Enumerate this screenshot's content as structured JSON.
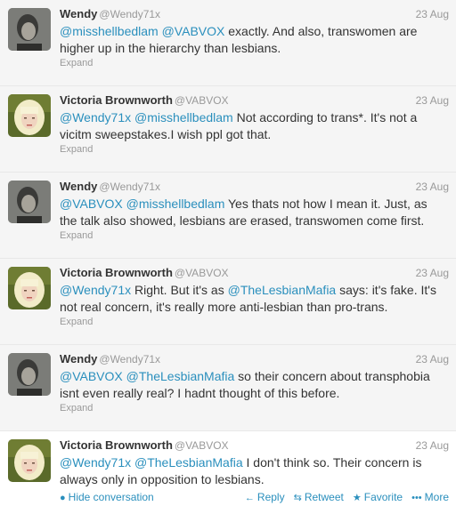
{
  "tweets": [
    {
      "fullname": "Wendy",
      "username": "@Wendy71x",
      "time": "23 Aug",
      "avatar": "wendy",
      "text_segments": [
        {
          "t": "@misshellbedlam",
          "m": true
        },
        {
          "t": " ",
          "m": false
        },
        {
          "t": "@VABVOX",
          "m": true
        },
        {
          "t": " exactly. And also, transwomen are higher up in the hierarchy than lesbians.",
          "m": false
        }
      ],
      "expand_label": "Expand"
    },
    {
      "fullname": "Victoria Brownworth",
      "username": "@VABVOX",
      "time": "23 Aug",
      "avatar": "victoria",
      "text_segments": [
        {
          "t": "@Wendy71x",
          "m": true
        },
        {
          "t": " ",
          "m": false
        },
        {
          "t": "@misshellbedlam",
          "m": true
        },
        {
          "t": " Not according to trans*. It's not a vicitm sweepstakes.I wish ppl got that.",
          "m": false
        }
      ],
      "expand_label": "Expand"
    },
    {
      "fullname": "Wendy",
      "username": "@Wendy71x",
      "time": "23 Aug",
      "avatar": "wendy",
      "text_segments": [
        {
          "t": "@VABVOX",
          "m": true
        },
        {
          "t": " ",
          "m": false
        },
        {
          "t": "@misshellbedlam",
          "m": true
        },
        {
          "t": " Yes thats not how I mean it. Just, as the talk also showed, lesbians are erased, transwomen come first.",
          "m": false
        }
      ],
      "expand_label": "Expand"
    },
    {
      "fullname": "Victoria Brownworth",
      "username": "@VABVOX",
      "time": "23 Aug",
      "avatar": "victoria",
      "text_segments": [
        {
          "t": "@Wendy71x",
          "m": true
        },
        {
          "t": " Right. But it's as ",
          "m": false
        },
        {
          "t": "@TheLesbianMafia",
          "m": true
        },
        {
          "t": " says: it's fake. It's not real concern, it's really more anti-lesbian than pro-trans.",
          "m": false
        }
      ],
      "expand_label": "Expand"
    },
    {
      "fullname": "Wendy",
      "username": "@Wendy71x",
      "time": "23 Aug",
      "avatar": "wendy",
      "text_segments": [
        {
          "t": "@VABVOX",
          "m": true
        },
        {
          "t": " ",
          "m": false
        },
        {
          "t": "@TheLesbianMafia",
          "m": true
        },
        {
          "t": " so their concern about transphobia isnt even really real? I hadnt thought of this before.",
          "m": false
        }
      ],
      "expand_label": "Expand"
    },
    {
      "fullname": "Victoria Brownworth",
      "username": "@VABVOX",
      "time": "23 Aug",
      "avatar": "victoria",
      "expanded": true,
      "text_segments": [
        {
          "t": "@Wendy71x",
          "m": true
        },
        {
          "t": " ",
          "m": false
        },
        {
          "t": "@TheLesbianMafia",
          "m": true
        },
        {
          "t": " I don't think so. Their concern is always only in opposition to lesbians.",
          "m": false
        }
      ],
      "actions": {
        "hide_label": "Hide conversation",
        "reply_label": "Reply",
        "retweet_label": "Retweet",
        "favorite_label": "Favorite",
        "more_label": "More"
      }
    }
  ],
  "colors": {
    "link": "#2a8fbd",
    "muted": "#999999",
    "text": "#333333",
    "row_background": "#f5f5f5"
  },
  "icons": {
    "hide": "speech-bubble-icon",
    "reply": "reply-arrow-icon",
    "retweet": "retweet-icon",
    "favorite": "star-icon",
    "more": "more-dots-icon"
  }
}
